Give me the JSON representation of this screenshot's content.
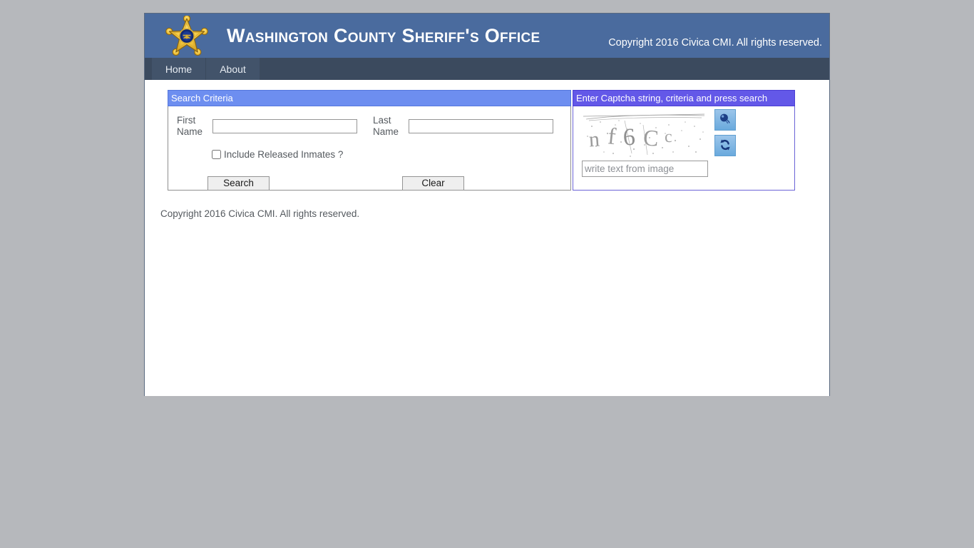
{
  "header": {
    "title": "Washington County Sheriff's Office",
    "copyright": "Copyright 2016 Civica CMI. All rights reserved.",
    "logo_icon": "sheriff-star-badge-icon"
  },
  "nav": {
    "items": [
      {
        "label": "Home"
      },
      {
        "label": "About"
      }
    ]
  },
  "search_panel": {
    "title": "Search Criteria",
    "first_name": {
      "label": "First Name",
      "label_line1": "First",
      "label_line2": "Name",
      "value": "",
      "placeholder": ""
    },
    "last_name": {
      "label": "Last Name",
      "label_line1": "Last",
      "label_line2": "Name",
      "value": "",
      "placeholder": ""
    },
    "include_released": {
      "label": "Include Released Inmates ?",
      "checked": false
    },
    "search_button": "Search",
    "clear_button": "Clear"
  },
  "captcha_panel": {
    "title": "Enter Captcha string, criteria and press search",
    "captcha_text": "nf6Cc",
    "audio_button_icon": "speaker-audio-icon",
    "refresh_button_icon": "refresh-icon",
    "input": {
      "value": "",
      "placeholder": "write text from image"
    }
  },
  "footer": {
    "copyright": "Copyright 2016 Civica CMI. All rights reserved."
  },
  "colors": {
    "page_background": "#b6b8bc",
    "header_blue": "#4a6b9e",
    "nav_dark": "#3b4a5e",
    "search_title_blue": "#6d8ef0",
    "captcha_title_purple": "#6358e8",
    "button_face": "#efefef",
    "captcha_btn_blue": "#6aaadd"
  }
}
